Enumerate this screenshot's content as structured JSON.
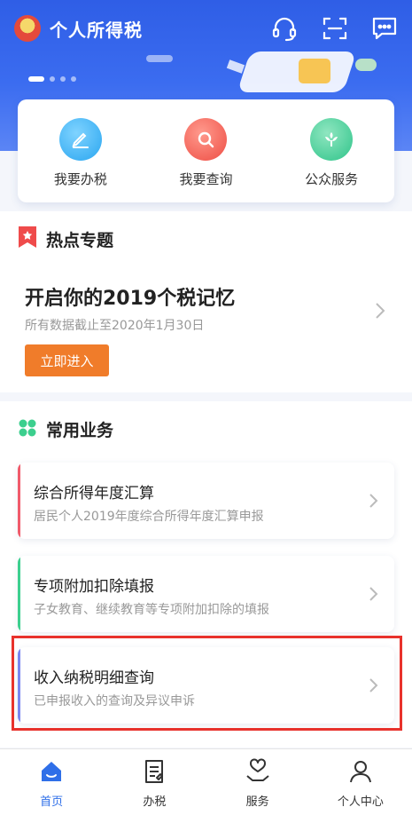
{
  "app": {
    "title": "个人所得税"
  },
  "quick_actions": [
    {
      "label": "我要办税",
      "icon": "pencil-icon"
    },
    {
      "label": "我要查询",
      "icon": "magnifier-icon"
    },
    {
      "label": "公众服务",
      "icon": "flower-icon"
    }
  ],
  "hot_topics": {
    "heading": "热点专题",
    "title": "开启你的2019个税记忆",
    "subtitle": "所有数据截止至2020年1月30日",
    "button": "立即进入"
  },
  "common_business": {
    "heading": "常用业务",
    "items": [
      {
        "title": "综合所得年度汇算",
        "subtitle": "居民个人2019年度综合所得年度汇算申报",
        "accent": "#f05a6a"
      },
      {
        "title": "专项附加扣除填报",
        "subtitle": "子女教育、继续教育等专项附加扣除的填报",
        "accent": "#3ccf8e"
      },
      {
        "title": "收入纳税明细查询",
        "subtitle": "已申报收入的查询及异议申诉",
        "accent": "#7b86f0"
      }
    ]
  },
  "tabs": [
    {
      "label": "首页",
      "icon": "home-icon",
      "active": true
    },
    {
      "label": "办税",
      "icon": "document-icon",
      "active": false
    },
    {
      "label": "服务",
      "icon": "heart-hand-icon",
      "active": false
    },
    {
      "label": "个人中心",
      "icon": "user-icon",
      "active": false
    }
  ],
  "colors": {
    "brand_blue": "#2f5ee6",
    "accent_orange": "#f07c2a",
    "highlight_red": "#e8322c",
    "active_tab": "#2f6fe8"
  }
}
